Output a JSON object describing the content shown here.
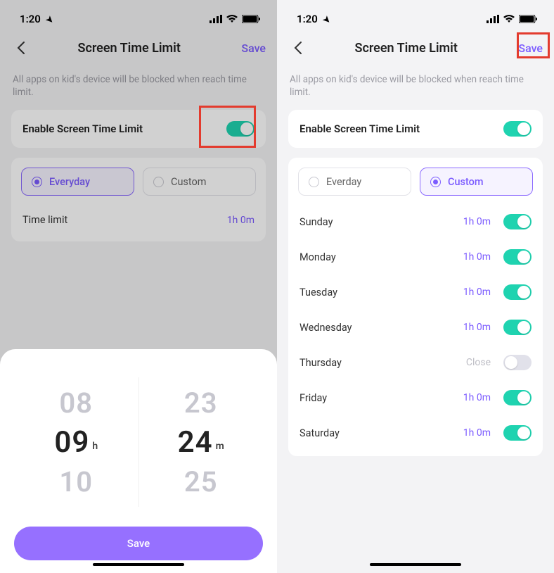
{
  "status": {
    "time": "1:20",
    "location_arrow": "➤"
  },
  "nav": {
    "title": "Screen Time Limit",
    "save": "Save"
  },
  "helper_text": "All apps on kid's device will be blocked when reach time limit.",
  "enable": {
    "label": "Enable Screen Time Limit"
  },
  "tabs": {
    "everyday_left": "Everyday",
    "custom_left": "Custom",
    "everyday_right": "Everday",
    "custom_right": "Custom"
  },
  "left": {
    "time_limit_label": "Time limit",
    "time_limit_value": "1h 0m"
  },
  "picker": {
    "h_prev": "08",
    "h_sel": "09",
    "h_next": "10",
    "m_prev": "23",
    "m_sel": "24",
    "m_next": "25",
    "h_unit": "h",
    "m_unit": "m",
    "save": "Save"
  },
  "right": {
    "days": [
      {
        "name": "Sunday",
        "value": "1h 0m",
        "on": true
      },
      {
        "name": "Monday",
        "value": "1h 0m",
        "on": true
      },
      {
        "name": "Tuesday",
        "value": "1h 0m",
        "on": true
      },
      {
        "name": "Wednesday",
        "value": "1h 0m",
        "on": true
      },
      {
        "name": "Thursday",
        "value": "Close",
        "on": false
      },
      {
        "name": "Friday",
        "value": "1h 0m",
        "on": true
      },
      {
        "name": "Saturday",
        "value": "1h 0m",
        "on": true
      }
    ]
  }
}
